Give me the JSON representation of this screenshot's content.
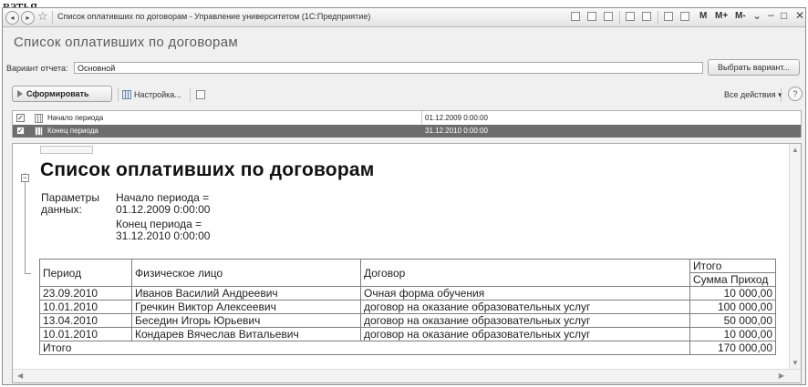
{
  "caption": "ватья.",
  "titlebar": {
    "title": "Список оплативших по договорам - Управление университетом (1С:Предприятие)",
    "m_labels": [
      "M",
      "M+",
      "M-"
    ]
  },
  "form": {
    "title": "Список оплативших по договорам",
    "variant_label": "Вариант отчета:",
    "variant_value": "Основной",
    "choose_variant": "Выбрать вариант...",
    "generate": "Сформировать",
    "settings": "Настройка...",
    "all_actions": "Все действия ▾",
    "help": "?"
  },
  "params": [
    {
      "name": "Начало периода",
      "value": "01.12.2009 0:00:00",
      "checked": true
    },
    {
      "name": "Конец периода",
      "value": "31.12.2010 0:00:00",
      "checked": true
    }
  ],
  "report": {
    "title": "Список оплативших по договорам",
    "params_label_1": "Параметры",
    "params_label_2": "данных:",
    "start_line_1": "Начало периода =",
    "start_line_2": "01.12.2009 0:00:00",
    "end_line_1": "Конец периода =",
    "end_line_2": "31.12.2010 0:00:00",
    "headers": {
      "period": "Период",
      "person": "Физическое лицо",
      "contract": "Договор",
      "total": "Итого",
      "sum": "Сумма Приход"
    },
    "rows": [
      {
        "period": "23.09.2010",
        "person": "Иванов Василий Андреевич",
        "contract": "Очная форма обучения",
        "sum": "10 000,00"
      },
      {
        "period": "10.01.2010",
        "person": "Гречкин Виктор Алексеевич",
        "contract": "договор на оказание образовательных услуг",
        "sum": "100 000,00"
      },
      {
        "period": "13.04.2010",
        "person": "Беседин Игорь Юрьевич",
        "contract": "договор на оказание образовательных услуг",
        "sum": "50 000,00"
      },
      {
        "period": "10.01.2010",
        "person": "Кондарев Вячеслав Витальевич",
        "contract": "договор на оказание образовательных услуг",
        "sum": "10 000,00"
      }
    ],
    "total_label": "Итого",
    "total_sum": "170 000,00"
  }
}
